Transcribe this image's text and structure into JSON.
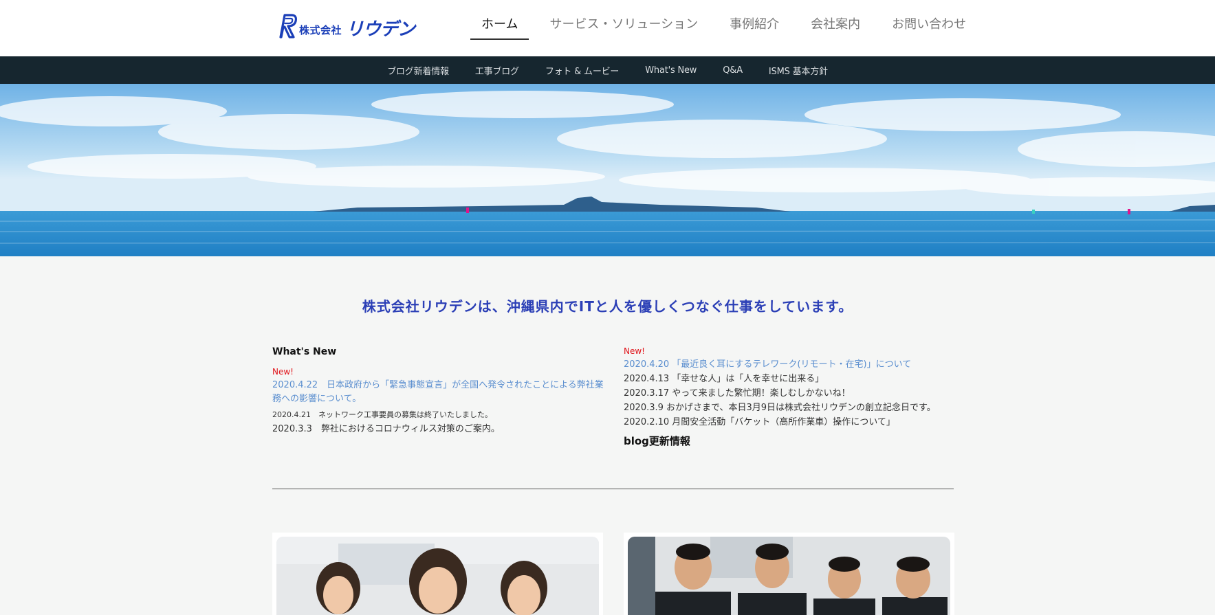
{
  "header": {
    "logo_small": "株式会社",
    "logo_big": "リウデン",
    "nav": [
      {
        "label": "ホーム",
        "active": true
      },
      {
        "label": "サービス・ソリューション"
      },
      {
        "label": "事例紹介"
      },
      {
        "label": "会社案内"
      },
      {
        "label": "お問い合わせ"
      }
    ]
  },
  "subnav": [
    {
      "label": "ブログ新着情報"
    },
    {
      "label": "工事ブログ"
    },
    {
      "label": "フォト & ムービー"
    },
    {
      "label": "What's New"
    },
    {
      "label": "Q&A"
    },
    {
      "label": "ISMS 基本方針"
    }
  ],
  "tagline": "株式会社リウデンは、沖縄県内でITと人を優しくつなぐ仕事をしています。",
  "whats_new": {
    "title": "What's New",
    "new_label": "New!",
    "featured": "2020.4.22　日本政府から「緊急事態宣言」が全国へ発令されたことによる弊社業務への影響について。",
    "items": [
      "2020.4.21　ネットワーク工事要員の募集は終了いたしました。",
      "2020.3.3　弊社におけるコロナウィルス対策のご案内。"
    ]
  },
  "blog": {
    "new_label": "New!",
    "featured": "2020.4.20 「最近良く耳にするテレワーク(リモート・在宅)」について",
    "items": [
      "2020.4.13 「幸せな人」は「人を幸せに出来る」",
      "2020.3.17 やって来ました繁忙期！楽しむしかないね！",
      "2020.3.9 おかげさまで、本日3月9日は株式会社リウデンの創立記念日です。",
      "2020.2.10 月間安全活動「バケット（高所作業車）操作について」"
    ],
    "title": "blog更新情報"
  },
  "colors": {
    "brand": "#1b3fb8",
    "tagline": "#2b3fb6",
    "subnav_bg": "#16262f",
    "new_red": "#e0141a",
    "link_blue": "#5a8ecf"
  }
}
